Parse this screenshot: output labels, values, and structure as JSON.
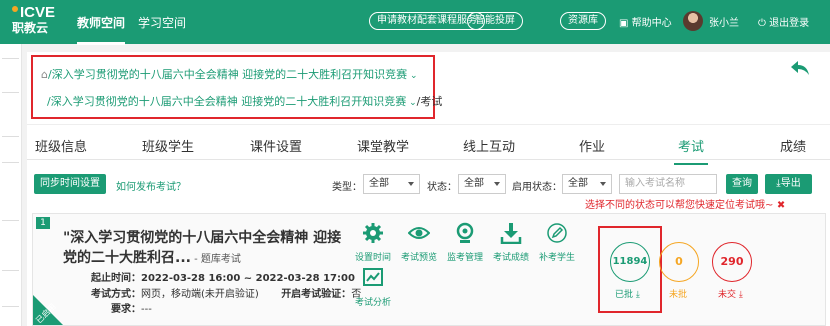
{
  "topbar": {
    "logo_top": "ICVE",
    "logo_bottom": "职教云",
    "nav": [
      "教师空间",
      "学习空间"
    ],
    "buttons": [
      "申请教材配套课程服务",
      "智能投屏",
      "资源库"
    ],
    "help": "帮助中心",
    "username": "张小兰",
    "logout": "退出登录"
  },
  "breadcrumb": {
    "level1": "/深入学习贯彻党的十八届六中全会精神 迎接党的二十大胜利召开知识竞赛",
    "level2": "/深入学习贯彻党的十八届六中全会精神 迎接党的二十大胜利召开知识竞赛",
    "current": "/考试"
  },
  "tabs": [
    "班级信息",
    "班级学生",
    "课件设置",
    "课堂教学",
    "线上互动",
    "作业",
    "考试",
    "成绩"
  ],
  "filters": {
    "sync_button": "同步时间设置",
    "help_link": "如何发布考试？",
    "type_label": "类型：",
    "type_value": "全部",
    "status_label": "状态：",
    "status_value": "全部",
    "enable_label": "启用状态：",
    "enable_value": "全部",
    "search_placeholder": "输入考试名称",
    "query_button": "查询",
    "export_button": "导出",
    "hint": "选择不同的状态可以帮您快速定位考试哦~"
  },
  "exam": {
    "index": "1",
    "title": "\"深入学习贯彻党的十八届六中全会精神 迎接党的二十大胜利召...",
    "source": " - 题库考试",
    "start_label": "起止时间：",
    "time_range": "2022-03-28 16:00 ~ 2022-03-28 17:00",
    "method_label": "考试方式：",
    "method_value": "网页，移动端(未开启验证)",
    "verify_label": "开启考试验证：",
    "verify_value": "否",
    "require_label": "要求：",
    "require_value": "---",
    "corner": "已启用",
    "actions": [
      "设置时间",
      "考试预览",
      "监考管理",
      "考试成绩",
      "补考学生",
      "考试分析"
    ],
    "stats": [
      {
        "value": "11894",
        "label": "已批",
        "color": "#1b9b74"
      },
      {
        "value": "0",
        "label": "未批",
        "color": "#f5a623"
      },
      {
        "value": "290",
        "label": "未交",
        "color": "#e0262c"
      }
    ]
  }
}
